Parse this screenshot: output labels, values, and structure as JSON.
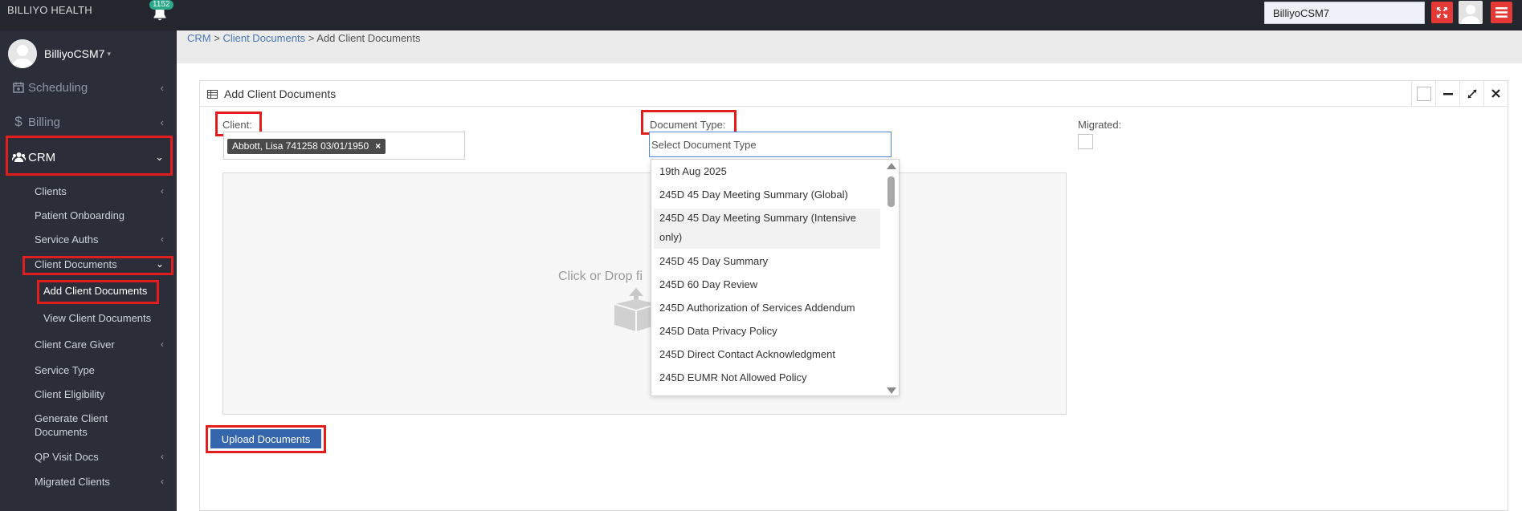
{
  "topbar": {
    "brand": "BILLIYO HEALTH",
    "notification_count": "1152",
    "user_select_value": "BilliyoCSM7"
  },
  "sidebar": {
    "profile_name": "BilliyoCSM7",
    "items": [
      {
        "label": "Scheduling",
        "icon": "calendar-plus-icon"
      },
      {
        "label": "Billing",
        "icon": "dollar-icon"
      },
      {
        "label": "CRM",
        "icon": "users-icon"
      }
    ],
    "crm_items": [
      {
        "label": "Clients"
      },
      {
        "label": "Patient Onboarding"
      },
      {
        "label": "Service Auths"
      },
      {
        "label": "Client Documents"
      },
      {
        "label": "Add Client Documents"
      },
      {
        "label": "View Client Documents"
      },
      {
        "label": "Client Care Giver"
      },
      {
        "label": "Service Type"
      },
      {
        "label": "Client Eligibility"
      },
      {
        "label": "Generate Client Documents"
      },
      {
        "label": "QP Visit Docs"
      },
      {
        "label": "Migrated Clients"
      }
    ]
  },
  "breadcrumb": {
    "crm": "CRM",
    "sep1": ">",
    "client_documents": "Client Documents",
    "sep2": ">",
    "current": "Add Client Documents"
  },
  "panel": {
    "title": "Add Client Documents"
  },
  "form": {
    "client_label": "Client:",
    "client_chip": "Abbott, Lisa 741258 03/01/1950",
    "chip_remove": "×",
    "doc_type_label": "Document Type:",
    "doc_type_placeholder": "Select Document Type",
    "migrated_label": "Migrated:",
    "dropzone_text": "Click or Drop fi",
    "upload_button": "Upload Documents"
  },
  "dropdown_options": [
    "19th Aug 2025",
    "245D 45 Day Meeting Summary (Global)",
    "245D 45 Day Meeting Summary (Intensive only)",
    "245D 45 Day Summary",
    "245D 60 Day Review",
    "245D Authorization of Services Addendum",
    "245D Data Privacy Policy",
    "245D Direct Contact Acknowledgment",
    "245D EUMR Not Allowed Policy"
  ],
  "colors": {
    "topbar": "#24262d",
    "sidebar": "#2b2e38",
    "highlight": "#e11d1d",
    "primary_button": "#3566ad",
    "danger": "#e53935",
    "badge": "#2aa889"
  }
}
